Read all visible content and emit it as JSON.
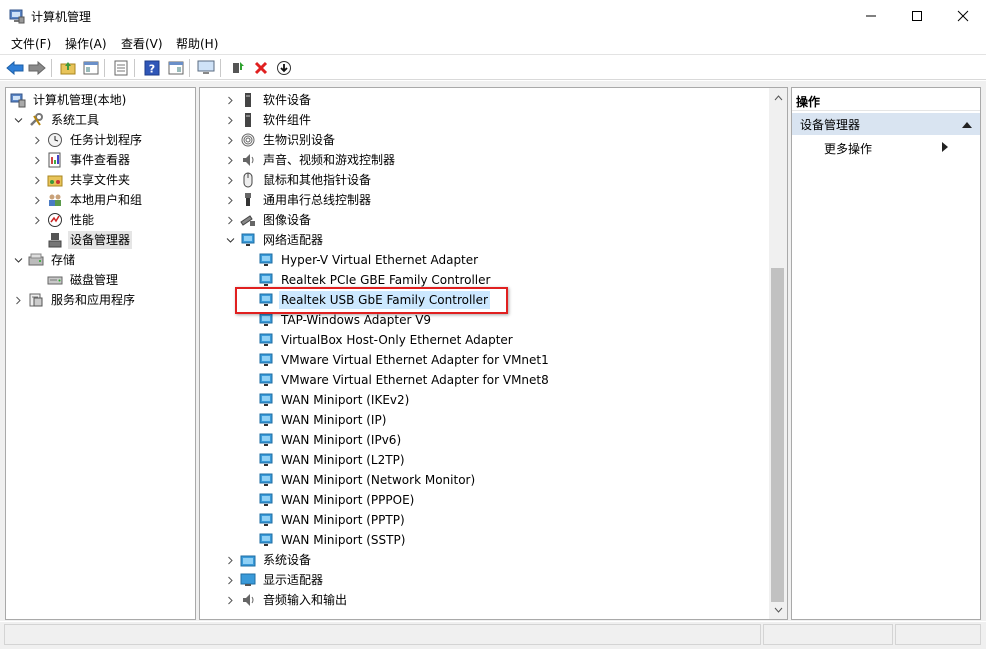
{
  "window": {
    "title": "计算机管理"
  },
  "menu": [
    "文件(F)",
    "操作(A)",
    "查看(V)",
    "帮助(H)"
  ],
  "tree": {
    "root": "计算机管理(本地)",
    "system_tools": "系统工具",
    "task_scheduler": "任务计划程序",
    "event_viewer": "事件查看器",
    "shared_folders": "共享文件夹",
    "local_users": "本地用户和组",
    "performance": "性能",
    "device_manager": "设备管理器",
    "storage": "存储",
    "disk_management": "磁盘管理",
    "services_apps": "服务和应用程序"
  },
  "devices": {
    "top_categories": [
      "软件设备",
      "软件组件",
      "生物识别设备",
      "声音、视频和游戏控制器",
      "鼠标和其他指针设备",
      "通用串行总线控制器",
      "图像设备"
    ],
    "network_category": "网络适配器",
    "network_adapters": [
      "Hyper-V Virtual Ethernet Adapter",
      "Realtek PCIe GBE Family Controller",
      "Realtek USB GbE Family Controller",
      "TAP-Windows Adapter V9",
      "VirtualBox Host-Only Ethernet Adapter",
      "VMware Virtual Ethernet Adapter for VMnet1",
      "VMware Virtual Ethernet Adapter for VMnet8",
      "WAN Miniport (IKEv2)",
      "WAN Miniport (IP)",
      "WAN Miniport (IPv6)",
      "WAN Miniport (L2TP)",
      "WAN Miniport (Network Monitor)",
      "WAN Miniport (PPPOE)",
      "WAN Miniport (PPTP)",
      "WAN Miniport (SSTP)"
    ],
    "bottom_categories": [
      "系统设备",
      "显示适配器",
      "音频输入和输出"
    ],
    "selected_adapter": "Realtek USB GbE Family Controller"
  },
  "actions": {
    "header": "操作",
    "section": "设备管理器",
    "more": "更多操作"
  },
  "colors": {
    "highlight_border": "#e02020",
    "selection": "#cce8ff",
    "section_bg": "#d9e4f1"
  }
}
